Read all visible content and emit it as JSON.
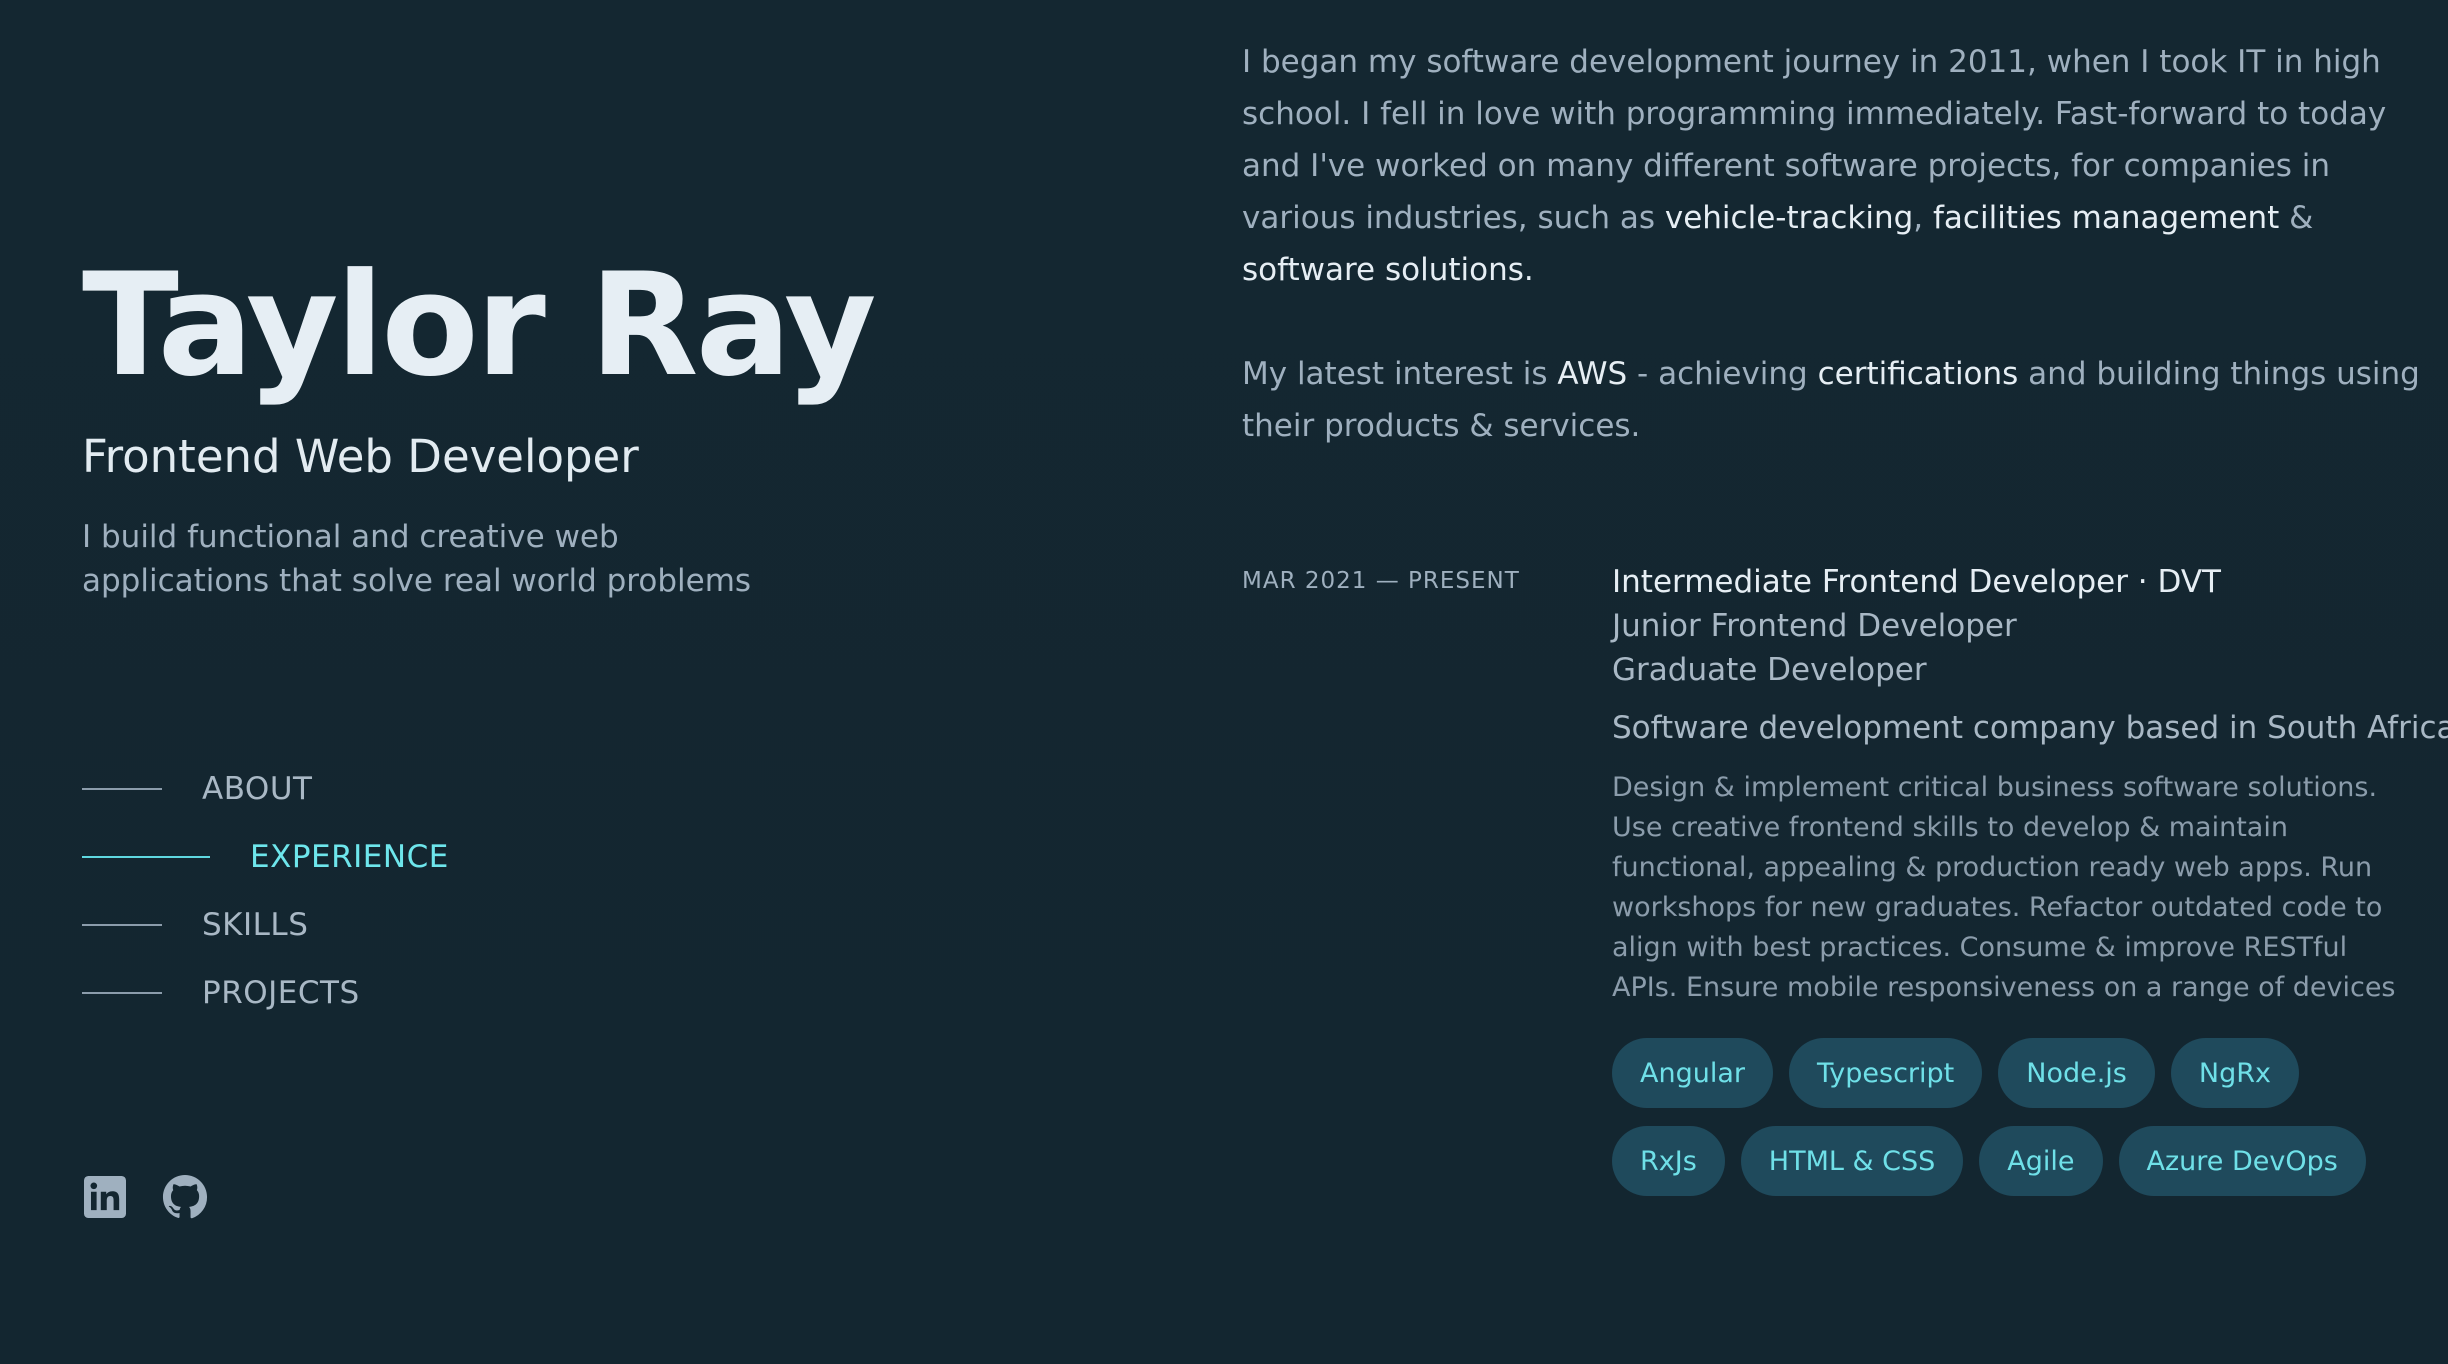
{
  "profile": {
    "name": "Taylor Ray",
    "role": "Frontend Web Developer",
    "tagline": "I build functional and creative web applications that solve real world problems"
  },
  "nav": {
    "items": [
      {
        "label": "ABOUT"
      },
      {
        "label": "EXPERIENCE"
      },
      {
        "label": "SKILLS"
      },
      {
        "label": "PROJECTS"
      }
    ],
    "active": "EXPERIENCE"
  },
  "socials": {
    "icons": [
      "linkedin-icon",
      "github-icon"
    ]
  },
  "about": {
    "p1_a": "I began my software development journey in 2011, when I took IT in high school. I fell in love with programming immediately. Fast-forward to today and I've worked on many different software projects, for companies in various industries, such as ",
    "p1_hl1": "vehicle-tracking",
    "p1_sep1": ", ",
    "p1_hl2": "facilities management",
    "p1_sep2": " & ",
    "p1_hl3": "software solutions.",
    "p2_a": "My latest interest is ",
    "p2_hl1": "AWS",
    "p2_b": " - achieving ",
    "p2_hl2": "certifications",
    "p2_c": " and building things using their products & services."
  },
  "experience": {
    "date": "MAR 2021 — PRESENT",
    "title": "Intermediate Frontend Developer · DVT",
    "previous_titles": [
      "Junior Frontend Developer",
      "Graduate Developer"
    ],
    "company": "Software development company based in South Africa",
    "description": "Design & implement critical business software solutions. Use creative frontend skills to develop & maintain functional, appealing & production ready web apps. Run workshops for new graduates. Refactor outdated code to align with best practices. Consume & improve RESTful APIs. Ensure mobile responsiveness on a range of devices",
    "tags": [
      "Angular",
      "Typescript",
      "Node.js",
      "NgRx",
      "RxJs",
      "HTML & CSS",
      "Agile",
      "Azure DevOps"
    ]
  },
  "colors": {
    "background": "#132630",
    "accent": "#6ee6ec",
    "tag_bg": "#1f4a5c"
  }
}
